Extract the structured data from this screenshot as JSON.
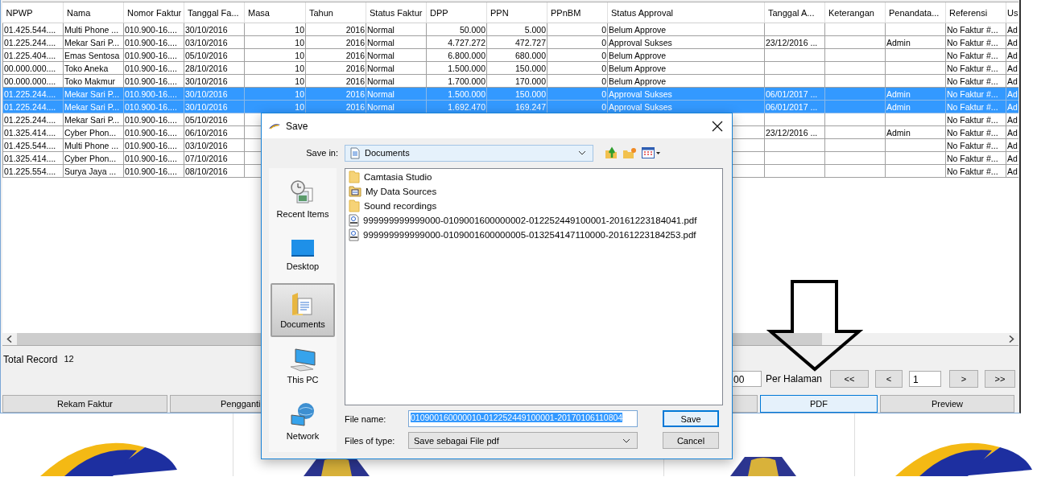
{
  "table": {
    "columns": [
      "NPWP",
      "Nama",
      "Nomor Faktur",
      "Tanggal Fa...",
      "Masa",
      "Tahun",
      "Status Faktur",
      "DPP",
      "PPN",
      "PPnBM",
      "Status Approval",
      "Tanggal A...",
      "Keterangan",
      "Penandata...",
      "Referensi",
      "Us"
    ],
    "rows": [
      {
        "selected": false,
        "cells": [
          "01.425.544....",
          "Multi Phone ...",
          "010.900-16....",
          "30/10/2016",
          "10",
          "2016",
          "Normal",
          "50.000",
          "5.000",
          "0",
          "Belum Approve",
          null,
          null,
          null,
          "No Faktur #...",
          "Ad"
        ]
      },
      {
        "selected": false,
        "cells": [
          "01.225.244....",
          "Mekar Sari P...",
          "010.900-16....",
          "03/10/2016",
          "10",
          "2016",
          "Normal",
          "4.727.272",
          "472.727",
          "0",
          "Approval Sukses",
          "23/12/2016 ...",
          null,
          "Admin",
          "No Faktur #...",
          "Ad"
        ]
      },
      {
        "selected": false,
        "cells": [
          "01.225.404....",
          "Emas Sentosa",
          "010.900-16....",
          "05/10/2016",
          "10",
          "2016",
          "Normal",
          "6.800.000",
          "680.000",
          "0",
          "Belum Approve",
          null,
          null,
          null,
          "No Faktur #...",
          "Ad"
        ]
      },
      {
        "selected": false,
        "cells": [
          "00.000.000....",
          "Toko Aneka",
          "010.900-16....",
          "28/10/2016",
          "10",
          "2016",
          "Normal",
          "1.500.000",
          "150.000",
          "0",
          "Belum Approve",
          null,
          null,
          null,
          "No Faktur #...",
          "Ad"
        ]
      },
      {
        "selected": false,
        "cells": [
          "00.000.000....",
          "Toko Makmur",
          "010.900-16....",
          "30/10/2016",
          "10",
          "2016",
          "Normal",
          "1.700.000",
          "170.000",
          "0",
          "Belum Approve",
          null,
          null,
          null,
          "No Faktur #...",
          "Ad"
        ]
      },
      {
        "selected": true,
        "cells": [
          "01.225.244....",
          "Mekar Sari P...",
          "010.900-16....",
          "30/10/2016",
          "10",
          "2016",
          "Normal",
          "1.500.000",
          "150.000",
          "0",
          "Approval Sukses",
          "06/01/2017 ...",
          null,
          "Admin",
          "No Faktur #...",
          "Ad"
        ]
      },
      {
        "selected": true,
        "cells": [
          "01.225.244....",
          "Mekar Sari P...",
          "010.900-16....",
          "30/10/2016",
          "10",
          "2016",
          "Normal",
          "1.692.470",
          "169.247",
          "0",
          "Approval Sukses",
          "06/01/2017 ...",
          null,
          "Admin",
          "No Faktur #...",
          "Ad"
        ]
      },
      {
        "selected": false,
        "cells": [
          "01.225.244....",
          "Mekar Sari P...",
          "010.900-16....",
          "05/10/2016",
          null,
          null,
          null,
          null,
          null,
          null,
          null,
          null,
          null,
          null,
          "No Faktur #...",
          "Ad"
        ]
      },
      {
        "selected": false,
        "cells": [
          "01.325.414....",
          "Cyber Phon...",
          "010.900-16....",
          "06/10/2016",
          null,
          null,
          null,
          null,
          null,
          null,
          null,
          "23/12/2016 ...",
          null,
          "Admin",
          "No Faktur #...",
          "Ad"
        ]
      },
      {
        "selected": false,
        "cells": [
          "01.425.544....",
          "Multi Phone ...",
          "010.900-16....",
          "03/10/2016",
          null,
          null,
          null,
          null,
          null,
          null,
          null,
          null,
          null,
          null,
          "No Faktur #...",
          "Ad"
        ]
      },
      {
        "selected": false,
        "cells": [
          "01.325.414....",
          "Cyber Phon...",
          "010.900-16....",
          "07/10/2016",
          null,
          null,
          null,
          null,
          null,
          null,
          null,
          null,
          null,
          null,
          "No Faktur #...",
          "Ad"
        ]
      },
      {
        "selected": false,
        "cells": [
          "01.225.554....",
          "Surya Jaya ...",
          "010.900-16....",
          "08/10/2016",
          null,
          null,
          null,
          null,
          null,
          null,
          null,
          null,
          null,
          null,
          "No Faktur #...",
          "Ad"
        ]
      }
    ]
  },
  "total_record": {
    "label": "Total Record",
    "value": "12"
  },
  "pagination": {
    "page_size": "00",
    "per_page_label": "Per Halaman",
    "first": "<<",
    "prev": "<",
    "page": "1",
    "next": ">",
    "last": ">>"
  },
  "buttons": [
    {
      "label": "Rekam Faktur",
      "focused": false
    },
    {
      "label": "Pengganti",
      "focused": false
    },
    {
      "label": "PDF",
      "focused": true
    },
    {
      "label": "Preview",
      "focused": false
    }
  ],
  "dialog": {
    "title": "Save",
    "save_in_label": "Save in:",
    "save_in_value": "Documents",
    "places": [
      {
        "label": "Recent Items",
        "kind": "recent",
        "selected": false
      },
      {
        "label": "Desktop",
        "kind": "desktop",
        "selected": false
      },
      {
        "label": "Documents",
        "kind": "documents",
        "selected": true
      },
      {
        "label": "This PC",
        "kind": "pc",
        "selected": false
      },
      {
        "label": "Network",
        "kind": "network",
        "selected": false
      }
    ],
    "files": [
      {
        "name": "Camtasia Studio",
        "kind": "folder"
      },
      {
        "name": "My Data Sources",
        "kind": "datafolder"
      },
      {
        "name": "Sound recordings",
        "kind": "folder"
      },
      {
        "name": "999999999999000-0109001600000002-012252449100001-20161223184041.pdf",
        "kind": "pdf"
      },
      {
        "name": "999999999999000-0109001600000005-013254147110000-20161223184253.pdf",
        "kind": "pdf"
      }
    ],
    "file_name_label": "File name:",
    "file_name_value": "010900160000010-012252449100001-20170106110804",
    "file_type_label": "Files of type:",
    "file_type_value": "Save sebagai File pdf",
    "save_button": "Save",
    "cancel_button": "Cancel"
  }
}
